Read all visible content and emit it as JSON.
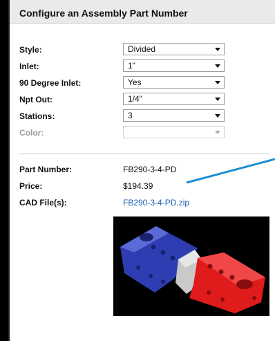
{
  "header": {
    "title": "Configure an Assembly Part Number"
  },
  "form": {
    "style": {
      "label": "Style:",
      "value": "Divided"
    },
    "inlet": {
      "label": "Inlet:",
      "value": "1\""
    },
    "degree_inlet": {
      "label": "90 Degree Inlet:",
      "value": "Yes"
    },
    "npt_out": {
      "label": "Npt Out:",
      "value": "1/4\""
    },
    "stations": {
      "label": "Stations:",
      "value": "3"
    },
    "color": {
      "label": "Color:",
      "value": ""
    }
  },
  "result": {
    "part_number": {
      "label": "Part Number:",
      "value": "FB290-3-4-PD"
    },
    "price": {
      "label": "Price:",
      "value": "$194.39"
    },
    "cad_files": {
      "label": "CAD File(s):",
      "value": "FB290-3-4-PD.zip"
    }
  },
  "image": {
    "icon": "manifold-block-image"
  },
  "colors": {
    "blue_section": "#2f3db3",
    "white_section": "#c9c9c9",
    "red_section": "#e01b1b",
    "annotation_line": "#1c8fd0"
  }
}
